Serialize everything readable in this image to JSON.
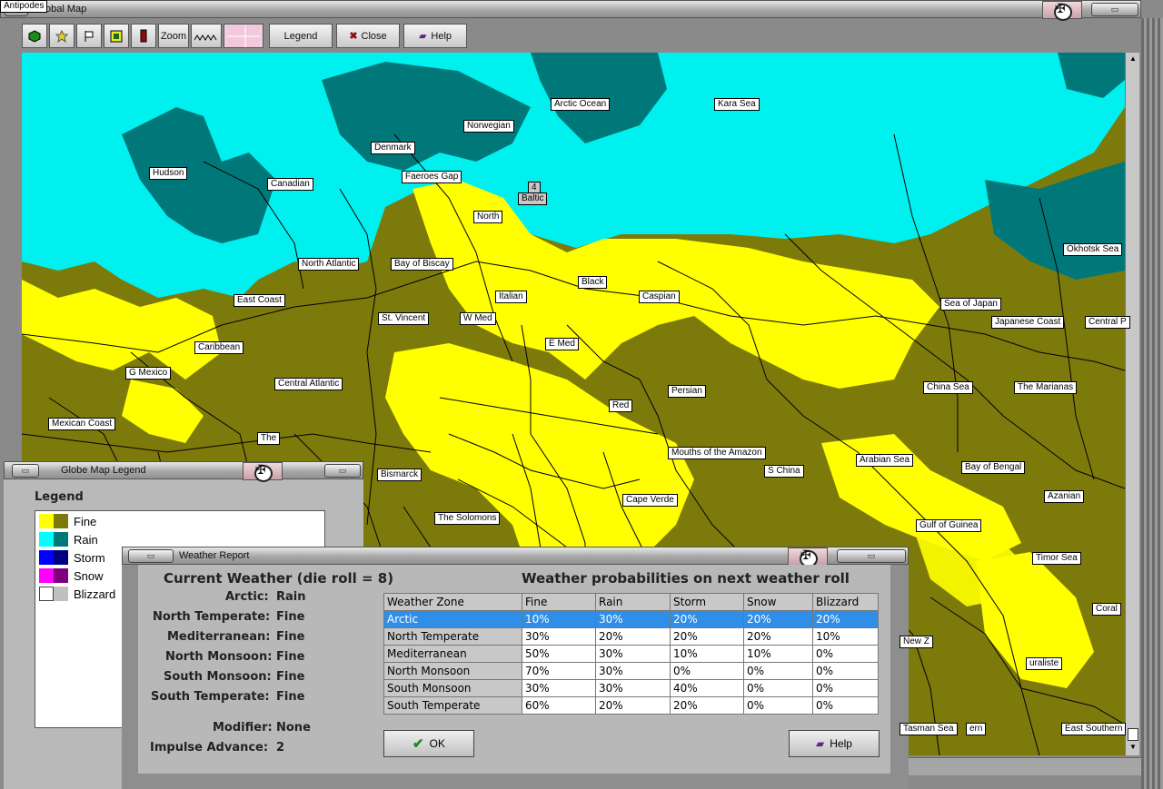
{
  "main_window": {
    "title": "Global Map",
    "toolbar": {
      "zoom_label": "Zoom",
      "legend_label": "Legend",
      "close_label": "Close",
      "help_label": "Help"
    }
  },
  "map": {
    "colors": {
      "fine_light": "#ffff00",
      "fine_dark": "#7d7a0c",
      "rain_light": "#00ffff",
      "rain_dark": "#00787a"
    },
    "sea_labels": [
      "Arctic Ocean",
      "Kara Sea",
      "Norwegian",
      "Denmark",
      "Hudson",
      "Canadian",
      "Faeroes Gap",
      "4",
      "Baltic",
      "North",
      "Bay of Biscay",
      "North Atlantic",
      "Black",
      "Okhotsk Sea",
      "East Coast",
      "Italian",
      "Caspian",
      "Sea of Japan",
      "St. Vincent",
      "W Med",
      "Japanese Coast",
      "Central P",
      "Caribbean",
      "E Med",
      "G Mexico",
      "Central Atlantic",
      "China Sea",
      "The Marianas",
      "Red",
      "Persian",
      "Mexican Coast",
      "The",
      "Mouths of the Amazon",
      "Arabian Sea",
      "S China",
      "Bay of Bengal",
      "Bismarck",
      "Cape Verde",
      "Azanian",
      "The Solomons",
      "Gulf of Guinea",
      "Timor Sea",
      "Coral",
      "New Z",
      "uraliste",
      "Tasman Sea",
      "ern",
      "East Southern",
      "Antipodes"
    ]
  },
  "legend_window": {
    "title": "Globe Map Legend",
    "heading": "Legend",
    "items": [
      {
        "label": "Fine",
        "c1": "#ffff00",
        "c2": "#7d7a0c"
      },
      {
        "label": "Rain",
        "c1": "#00ffff",
        "c2": "#00787a"
      },
      {
        "label": "Storm",
        "c1": "#0000ff",
        "c2": "#000080"
      },
      {
        "label": "Snow",
        "c1": "#ff00ff",
        "c2": "#800080"
      },
      {
        "label": "Blizzard",
        "c1": "#ffffff",
        "c2": "#c0c0c0"
      }
    ]
  },
  "weather_report": {
    "title": "Weather Report",
    "current_heading": "Current Weather (die roll = 8)",
    "prob_heading": "Weather probabilities on next weather roll",
    "current": [
      {
        "zone": "Arctic:",
        "value": "Rain"
      },
      {
        "zone": "North Temperate:",
        "value": "Fine"
      },
      {
        "zone": "Mediterranean:",
        "value": "Fine"
      },
      {
        "zone": "North Monsoon:",
        "value": "Fine"
      },
      {
        "zone": "South Monsoon:",
        "value": "Fine"
      },
      {
        "zone": "South Temperate:",
        "value": "Fine"
      }
    ],
    "modifier_label": "Modifier:",
    "modifier_value": "None",
    "impulse_label": "Impulse Advance:",
    "impulse_value": "2",
    "table": {
      "headers": [
        "Weather Zone",
        "Fine",
        "Rain",
        "Storm",
        "Snow",
        "Blizzard"
      ],
      "selected_row": 0,
      "rows": [
        [
          "Arctic",
          "10%",
          "30%",
          "20%",
          "20%",
          "20%"
        ],
        [
          "North Temperate",
          "30%",
          "20%",
          "20%",
          "20%",
          "10%"
        ],
        [
          "Mediterranean",
          "50%",
          "30%",
          "10%",
          "10%",
          "0%"
        ],
        [
          "North Monsoon",
          "70%",
          "30%",
          "0%",
          "0%",
          "0%"
        ],
        [
          "South Monsoon",
          "30%",
          "30%",
          "40%",
          "0%",
          "0%"
        ],
        [
          "South Temperate",
          "60%",
          "20%",
          "20%",
          "0%",
          "0%"
        ]
      ]
    },
    "ok_label": "OK",
    "help_label": "Help"
  }
}
